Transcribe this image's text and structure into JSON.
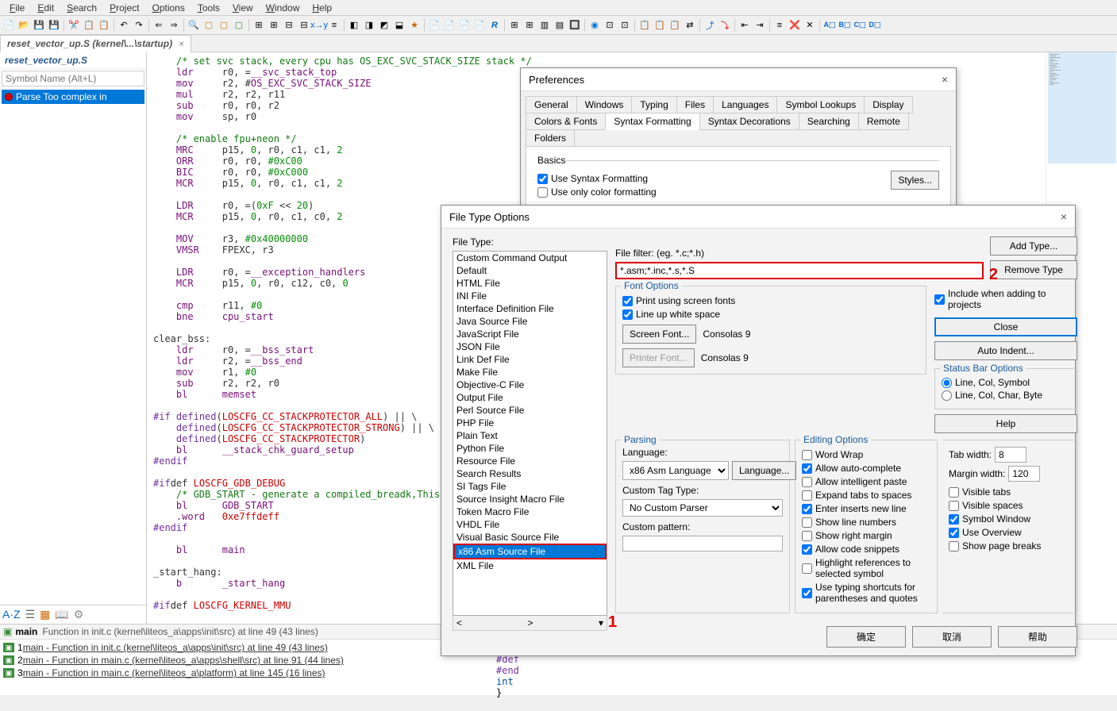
{
  "menu": [
    "File",
    "Edit",
    "Search",
    "Project",
    "Options",
    "Tools",
    "View",
    "Window",
    "Help"
  ],
  "tab": {
    "name": "reset_vector_up.S (kernel\\...\\startup)"
  },
  "sidebar": {
    "title": "reset_vector_up.S",
    "search_placeholder": "Symbol Name (Alt+L)",
    "item": "Parse Too complex in"
  },
  "code_lines": [
    [
      "comment",
      "    /* set svc stack, every cpu has OS_EXC_SVC_STACK_SIZE stack */"
    ],
    [
      "asm",
      "    ldr     r0, =__svc_stack_top"
    ],
    [
      "asm",
      "    mov     r2, #OS_EXC_SVC_STACK_SIZE"
    ],
    [
      "asm",
      "    mul     r2, r2, r11"
    ],
    [
      "asm",
      "    sub     r0, r0, r2"
    ],
    [
      "asm",
      "    mov     sp, r0"
    ],
    [
      "blank",
      ""
    ],
    [
      "comment",
      "    /* enable fpu+neon */"
    ],
    [
      "asm",
      "    MRC     p15, 0, r0, c1, c1, 2"
    ],
    [
      "asm",
      "    ORR     r0, r0, #0xC00"
    ],
    [
      "asm",
      "    BIC     r0, r0, #0xC000"
    ],
    [
      "asm",
      "    MCR     p15, 0, r0, c1, c1, 2"
    ],
    [
      "blank",
      ""
    ],
    [
      "asm",
      "    LDR     r0, =(0xF << 20)"
    ],
    [
      "asm",
      "    MCR     p15, 0, r0, c1, c0, 2"
    ],
    [
      "blank",
      ""
    ],
    [
      "asm",
      "    MOV     r3, #0x40000000"
    ],
    [
      "asm",
      "    VMSR    FPEXC, r3"
    ],
    [
      "blank",
      ""
    ],
    [
      "asm",
      "    LDR     r0, =__exception_handlers"
    ],
    [
      "asm",
      "    MCR     p15, 0, r0, c12, c0, 0"
    ],
    [
      "blank",
      ""
    ],
    [
      "asm",
      "    cmp     r11, #0"
    ],
    [
      "asm",
      "    bne     cpu_start"
    ],
    [
      "blank",
      ""
    ],
    [
      "label",
      "clear_bss:"
    ],
    [
      "asm",
      "    ldr     r0, =__bss_start"
    ],
    [
      "asm",
      "    ldr     r2, =__bss_end"
    ],
    [
      "asm",
      "    mov     r1, #0"
    ],
    [
      "asm",
      "    sub     r2, r2, r0"
    ],
    [
      "asm",
      "    bl      memset"
    ],
    [
      "blank",
      ""
    ],
    [
      "pp",
      "#if defined(LOSCFG_CC_STACKPROTECTOR_ALL) || \\"
    ],
    [
      "pp",
      "    defined(LOSCFG_CC_STACKPROTECTOR_STRONG) || \\"
    ],
    [
      "pp",
      "    defined(LOSCFG_CC_STACKPROTECTOR)"
    ],
    [
      "asm",
      "    bl      __stack_chk_guard_setup"
    ],
    [
      "pp",
      "#endif"
    ],
    [
      "blank",
      ""
    ],
    [
      "pp",
      "#ifdef LOSCFG_GDB_DEBUG"
    ],
    [
      "comment",
      "    /* GDB_START - generate a compiled_breadk,This fund"
    ],
    [
      "asm",
      "    bl      GDB_START"
    ],
    [
      "asm",
      "    .word   0xe7ffdeff"
    ],
    [
      "pp",
      "#endif"
    ],
    [
      "blank",
      ""
    ],
    [
      "asm",
      "    bl      main"
    ],
    [
      "blank",
      ""
    ],
    [
      "label",
      "_start_hang:"
    ],
    [
      "asm",
      "    b       _start_hang"
    ],
    [
      "blank",
      ""
    ],
    [
      "pp",
      "#ifdef LOSCFG_KERNEL_MMU"
    ]
  ],
  "bottom": {
    "header_main": "main",
    "header_sub": "Function in init.c (kernel\\liteos_a\\apps\\init\\src) at line 49 (43 lines)",
    "rows": [
      {
        "n": "1",
        "text": "main - Function in init.c (kernel\\liteos_a\\apps\\init\\src) at line 49 (43 lines)"
      },
      {
        "n": "2",
        "text": "main - Function in main.c (kernel\\liteos_a\\apps\\shell\\src) at line 91 (44 lines)"
      },
      {
        "n": "3",
        "text": "main - Function in main.c (kernel\\liteos_a\\platform) at line 145 (16 lines)"
      }
    ]
  },
  "prefs": {
    "title": "Preferences",
    "tabs_row1": [
      "General",
      "Windows",
      "Typing",
      "Files",
      "Languages",
      "Symbol Lookups",
      "Display"
    ],
    "tabs_row2": [
      "Colors & Fonts",
      "Syntax Formatting",
      "Syntax Decorations",
      "Searching",
      "Remote",
      "Folders"
    ],
    "active_tab": "Syntax Formatting",
    "basics_legend": "Basics",
    "chk_use": "Use Syntax Formatting",
    "chk_color": "Use only color formatting",
    "styles_btn": "Styles..."
  },
  "fto": {
    "title": "File Type Options",
    "file_type_label": "File Type:",
    "filter_label": "File filter: (eg. *.c;*.h)",
    "filter_value": "*.asm;*.inc,*.s,*.S",
    "list": [
      "Custom Command Output",
      "Default",
      "HTML File",
      "INI File",
      "Interface Definition File",
      "Java Source File",
      "JavaScript File",
      "JSON File",
      "Link Def File",
      "Make File",
      "Objective-C File",
      "Output File",
      "Perl Source File",
      "PHP File",
      "Plain Text",
      "Python File",
      "Resource File",
      "Search Results",
      "SI Tags File",
      "Source Insight Macro File",
      "Token Macro File",
      "VHDL File",
      "Visual Basic Source File",
      "x86 Asm Source File",
      "XML File"
    ],
    "selected": "x86 Asm Source File",
    "buttons": {
      "add": "Add Type...",
      "remove": "Remove Type",
      "close": "Close",
      "auto": "Auto Indent...",
      "help": "Help"
    },
    "font": {
      "legend": "Font Options",
      "print": "Print using screen fonts",
      "lineup": "Line up white space",
      "screen_btn": "Screen Font...",
      "printer_btn": "Printer Font...",
      "font_name": "Consolas 9"
    },
    "include_chk": "Include when adding to projects",
    "status": {
      "legend": "Status Bar Options",
      "r1": "Line, Col, Symbol",
      "r2": "Line, Col, Char, Byte"
    },
    "parsing": {
      "legend": "Parsing",
      "lang_label": "Language:",
      "lang_value": "x86 Asm Language",
      "lang_btn": "Language...",
      "custom_tag_label": "Custom Tag Type:",
      "custom_tag_value": "No Custom Parser",
      "pattern_label": "Custom pattern:"
    },
    "editing": {
      "legend": "Editing Options",
      "ww": "Word Wrap",
      "ac": "Allow auto-complete",
      "ip": "Allow intelligent paste",
      "et": "Expand tabs to spaces",
      "ei": "Enter inserts new line",
      "ln": "Show line numbers",
      "rm": "Show right margin",
      "cs": "Allow code snippets",
      "hl": "Highlight references to selected symbol",
      "ts": "Use typing shortcuts for parentheses and quotes",
      "tab_label": "Tab width:",
      "tab_val": "8",
      "margin_label": "Margin width:",
      "margin_val": "120",
      "vt": "Visible tabs",
      "vs": "Visible spaces",
      "sw": "Symbol Window",
      "uo": "Use Overview",
      "pb": "Show page breaks"
    },
    "bottom_btns": [
      "确定",
      "取消",
      "帮助"
    ]
  },
  "snip": [
    "#def",
    "#end",
    "int",
    "}"
  ]
}
